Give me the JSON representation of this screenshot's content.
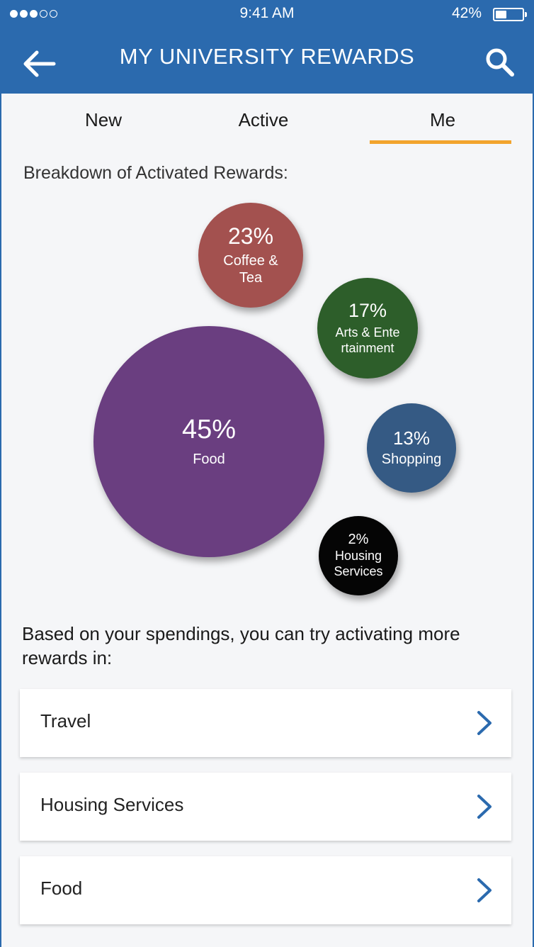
{
  "status_bar": {
    "time": "9:41 AM",
    "battery_percent": "42%",
    "signal_bars_filled": 3,
    "signal_bars_total": 5
  },
  "header": {
    "title": "MY UNIVERSITY REWARDS",
    "back_icon": "back-arrow-icon",
    "search_icon": "search-icon"
  },
  "tabs": [
    {
      "label": "New",
      "selected": false
    },
    {
      "label": "Active",
      "selected": false
    },
    {
      "label": "Me",
      "selected": true
    }
  ],
  "breakdown_title": "Breakdown of Activated Rewards:",
  "chart_data": {
    "type": "bubble",
    "items": [
      {
        "percent": "45%",
        "value": 45,
        "label": "Food",
        "color": "#6a3e80"
      },
      {
        "percent": "23%",
        "value": 23,
        "label": "Coffee & Tea",
        "color": "#a3514f"
      },
      {
        "percent": "17%",
        "value": 17,
        "label": "Arts & Entertainment",
        "color": "#2d5e2a"
      },
      {
        "percent": "13%",
        "value": 13,
        "label": "Shopping",
        "color": "#355a84"
      },
      {
        "percent": "2%",
        "value": 2,
        "label": "Housing Services",
        "color": "#050505"
      }
    ]
  },
  "suggestion_text": "Based on your spendings, you can try activating more rewards in:",
  "suggestions": [
    {
      "label": "Travel"
    },
    {
      "label": "Housing Services"
    },
    {
      "label": "Food"
    }
  ],
  "colors": {
    "header_bg": "#2b6aae",
    "tab_indicator": "#f2a42d",
    "chevron": "#2b6aae",
    "background": "#f5f6f8"
  }
}
